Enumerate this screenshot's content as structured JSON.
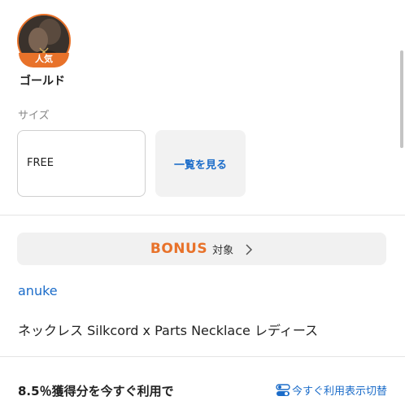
{
  "color_option": {
    "badge": "人気",
    "name": "ゴールド"
  },
  "size": {
    "label": "サイズ",
    "selected": "FREE",
    "view_all": "一覧を見る"
  },
  "bonus": {
    "word": "BONUS",
    "target": "対象"
  },
  "product": {
    "brand": "anuke",
    "name": "ネックレス Silkcord x Parts Necklace レディース"
  },
  "points": {
    "text": "8.5％獲得分を今すぐ利用で",
    "toggle": "今すぐ利用表示切替"
  },
  "colors": {
    "accent_orange": "#e8722a",
    "link_blue": "#1b6cc9"
  }
}
